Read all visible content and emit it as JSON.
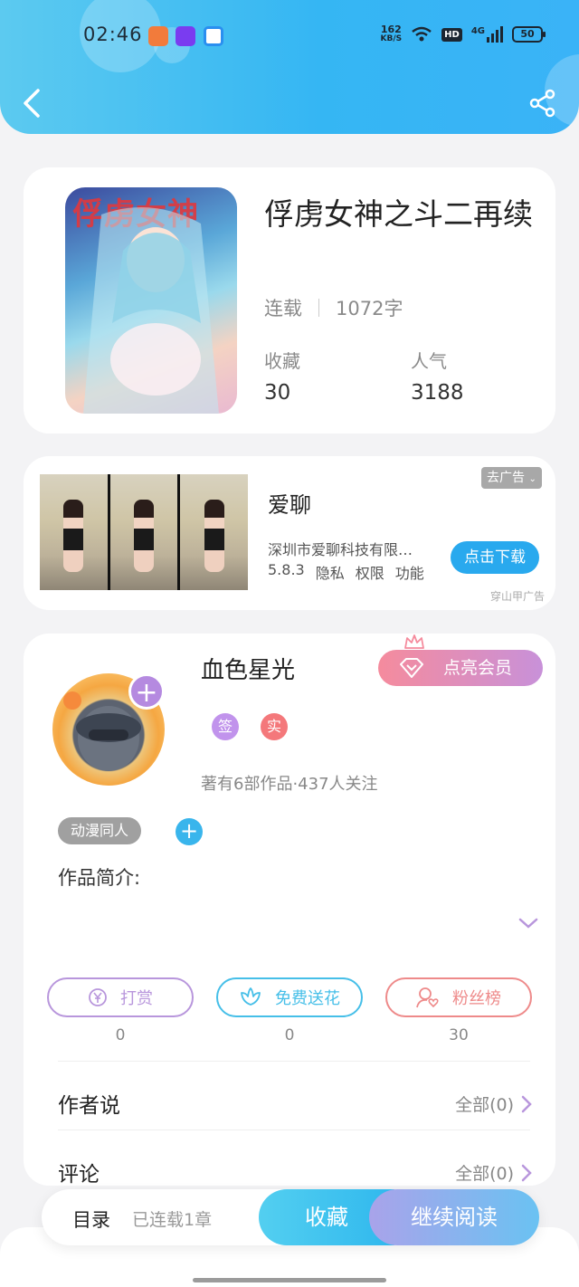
{
  "status_bar": {
    "time": "02:46",
    "speed_value": "162",
    "speed_unit": "KB/S",
    "hd": "HD",
    "network": "4G",
    "battery": "50"
  },
  "book": {
    "cover_title_text": "俘虏女神",
    "title": "俘虏女神之斗二再续",
    "status": "连载",
    "word_count": "1072字",
    "favorites_label": "收藏",
    "favorites_value": "30",
    "popularity_label": "人气",
    "popularity_value": "3188"
  },
  "ad": {
    "app_name": "爱聊",
    "company": "深圳市爱聊科技有限…",
    "version": "5.8.3",
    "privacy": "隐私",
    "permissions": "权限",
    "features": "功能",
    "download_label": "点击下载",
    "close_label": "去广告",
    "source": "穿山甲广告"
  },
  "author": {
    "name": "血色星光",
    "vip_label": "点亮会员",
    "tag_sign": "签",
    "tag_real": "实",
    "info": "著有6部作品·437人关注",
    "genre_tag": "动漫同人",
    "intro_label": "作品简介:"
  },
  "actions": [
    {
      "label": "打赏",
      "count": "0",
      "color": "#b896dc",
      "icon": "yen-icon"
    },
    {
      "label": "免费送花",
      "count": "0",
      "color": "#46bfe8",
      "icon": "flower-icon"
    },
    {
      "label": "粉丝榜",
      "count": "30",
      "color": "#ee8a8a",
      "icon": "fan-icon"
    }
  ],
  "sections": {
    "author_says": "作者说",
    "author_says_all": "全部(0)",
    "comments": "评论",
    "comments_all": "全部(0)"
  },
  "bottom_bar": {
    "toc": "目录",
    "serial_status": "已连载1章",
    "favorite": "收藏",
    "continue_reading": "继续阅读"
  }
}
